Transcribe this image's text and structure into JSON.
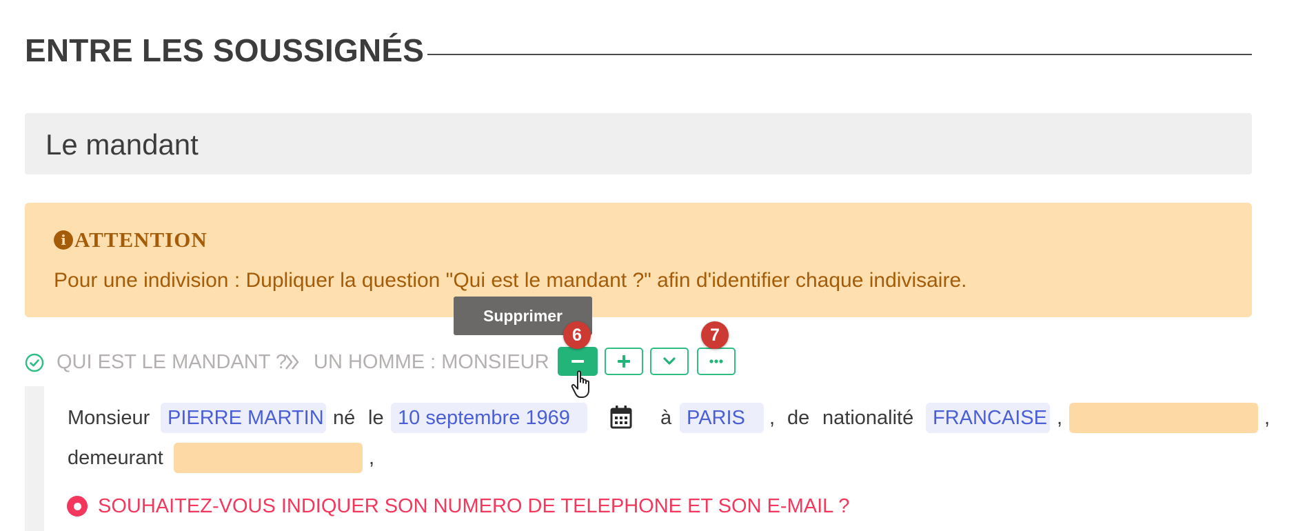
{
  "section": {
    "title": "ENTRE LES SOUSSIGNÉS"
  },
  "party": {
    "label": "Le mandant"
  },
  "warning": {
    "icon": "info-circle-icon",
    "title": "ATTENTION",
    "text": "Pour une indivision : Dupliquer la question \"Qui est le mandant ?\" afin d'identifier chaque indivisaire."
  },
  "tooltip": {
    "text": "Supprimer"
  },
  "question": {
    "label": "QUI EST LE MANDANT ?",
    "answer": "UN HOMME : MONSIEUR",
    "status_icon": "check-circle-icon",
    "separator_icon": "double-chevron-right-icon"
  },
  "actions": {
    "remove_icon": "minus-icon",
    "add_icon": "plus-icon",
    "expand_icon": "chevron-down-icon",
    "more_icon": "ellipsis-icon"
  },
  "badges": {
    "remove": "6",
    "more": "7"
  },
  "sentence": {
    "civility": "Monsieur",
    "name": "PIERRE MARTIN",
    "born_word": "né",
    "le_word": "le",
    "birth_date": "10 septembre 1969",
    "a_word": "à",
    "birth_place": "PARIS",
    "comma1": ",",
    "de_word": "de",
    "nationality_word": "nationalité",
    "nationality": "FRANCAISE",
    "comma2": ",",
    "extra_field": "",
    "comma3": ",",
    "residing_word": "demeurant",
    "address": "",
    "comma4": ","
  },
  "sub_question": {
    "label": "SOUHAITEZ-VOUS INDIQUER SON NUMERO DE TELEPHONE ET SON E-MAIL ?"
  },
  "colors": {
    "accent_green": "#23b47a",
    "warning_bg": "#fddfb0",
    "warning_text": "#a55c08",
    "field_text": "#4a5fd6",
    "alert_red": "#f4375c",
    "badge_red": "#cc3a33"
  }
}
